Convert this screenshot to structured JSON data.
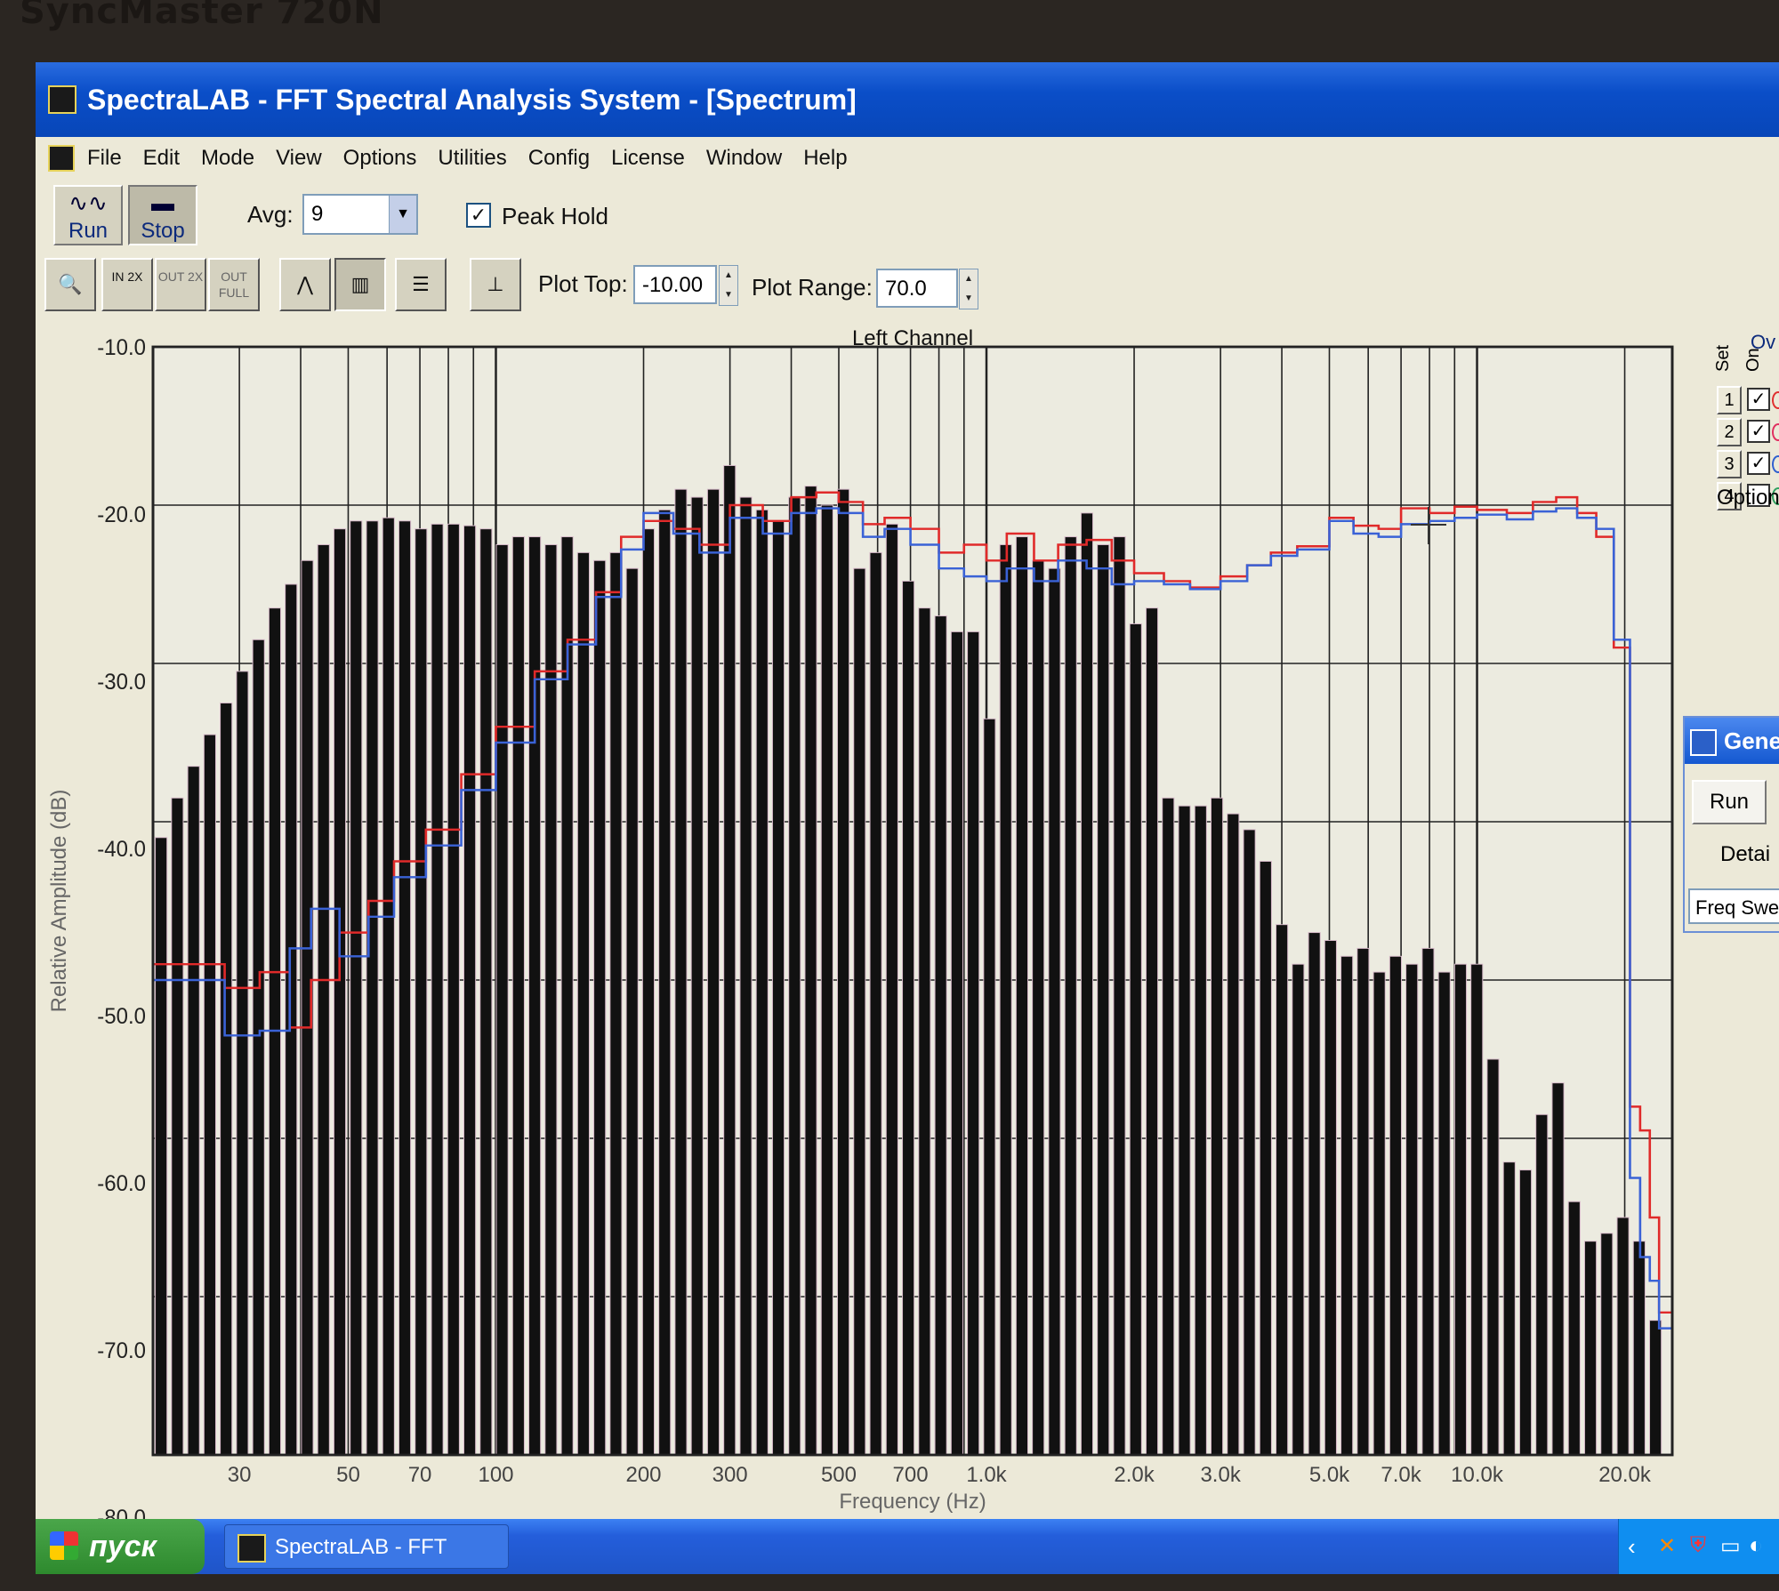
{
  "bezel": {
    "label": "SyncMaster 720N"
  },
  "window": {
    "title": "SpectraLAB - FFT Spectral Analysis System - [Spectrum]"
  },
  "menu": [
    "File",
    "Edit",
    "Mode",
    "View",
    "Options",
    "Utilities",
    "Config",
    "License",
    "Window",
    "Help"
  ],
  "toolbar": {
    "run_label": "Run",
    "stop_label": "Stop",
    "avg_label": "Avg:",
    "avg_value": "9",
    "peak_hold_label": "Peak Hold",
    "peak_hold_checked": true,
    "zoom_in_label": "IN 2X",
    "zoom_out_label": "OUT 2X",
    "zoom_full_label": "OUT FULL",
    "plot_top_label": "Plot Top:",
    "plot_top_value": "-10.00",
    "plot_range_label": "Plot Range:",
    "plot_range_value": "70.0"
  },
  "overlay_panel": {
    "header_partial": "Ov",
    "set_label": "Set",
    "on_label": "On",
    "rows": [
      {
        "set": "1",
        "on": true,
        "color": "#e03030"
      },
      {
        "set": "2",
        "on": true,
        "color": "#e03060"
      },
      {
        "set": "3",
        "on": true,
        "color": "#3060d0"
      },
      {
        "set": "4",
        "on": false,
        "color": "#30a060"
      }
    ],
    "options_label": "Option"
  },
  "generator_panel": {
    "title": "Gene",
    "run_label": "Run",
    "details_label": "Detai",
    "mode_label": "Freq Swe"
  },
  "taskbar": {
    "start_label": "пуск",
    "task_label": "SpectraLAB - FFT Spe..."
  },
  "chart_data": {
    "type": "bar",
    "title": "Left Channel",
    "xlabel": "Frequency (Hz)",
    "ylabel": "Relative Amplitude (dB)",
    "xscale": "log",
    "xlim": [
      20,
      25000
    ],
    "ylim": [
      -80,
      -10
    ],
    "yticks": [
      -10.0,
      -20.0,
      -30.0,
      -40.0,
      -50.0,
      -60.0,
      -70.0,
      -80.0
    ],
    "ytick_labels": [
      "-10.0",
      "-20.0",
      "-30.0",
      "-40.0",
      "-50.0",
      "-60.0",
      "-70.0",
      "-80.0"
    ],
    "xticks": [
      30,
      50,
      70,
      100,
      200,
      300,
      500,
      700,
      1000,
      2000,
      3000,
      5000,
      7000,
      10000,
      20000
    ],
    "xtick_labels": [
      "30",
      "50",
      "70",
      "100",
      "200",
      "300",
      "500",
      "700",
      "1.0k",
      "2.0k",
      "3.0k",
      "5.0k",
      "7.0k",
      "10.0k",
      "20.0k"
    ],
    "grid": true,
    "bars": {
      "name": "Spectrum",
      "freq_start": 20,
      "freq_end": 24000,
      "values": [
        -41.0,
        -38.5,
        -36.5,
        -34.5,
        -32.5,
        -30.5,
        -28.5,
        -26.5,
        -25.0,
        -23.5,
        -22.5,
        -21.5,
        -21.0,
        -21.0,
        -20.8,
        -21.0,
        -21.5,
        -21.2,
        -21.2,
        -21.3,
        -21.5,
        -22.5,
        -22.0,
        -22.0,
        -22.5,
        -22.0,
        -23.0,
        -23.5,
        -23.0,
        -24.0,
        -21.5,
        -20.3,
        -19.0,
        -19.5,
        -19.0,
        -17.5,
        -19.5,
        -20.3,
        -21.0,
        -19.5,
        -18.8,
        -20.0,
        -19.0,
        -24.0,
        -23.0,
        -21.2,
        -24.8,
        -26.5,
        -27.0,
        -28.0,
        -28.0,
        -33.5,
        -22.5,
        -22.0,
        -23.5,
        -24.0,
        -22.0,
        -20.5,
        -22.5,
        -22.0,
        -27.5,
        -26.5,
        -38.5,
        -39.0,
        -39.0,
        -38.5,
        -39.5,
        -40.5,
        -42.5,
        -46.5,
        -49.0,
        -47.0,
        -47.5,
        -48.5,
        -48.0,
        -49.5,
        -48.5,
        -49.0,
        -48.0,
        -49.5,
        -49.0,
        -49.0,
        -55.0,
        -61.5,
        -62.0,
        -58.5,
        -56.5,
        -64.0,
        -66.5,
        -66.0,
        -65.0,
        -66.5,
        -71.5
      ]
    },
    "series": [
      {
        "name": "Overlay 1",
        "color": "#e02a2a",
        "points": [
          [
            20,
            -49.0
          ],
          [
            28,
            -50.5
          ],
          [
            33,
            -49.5
          ],
          [
            38,
            -53.0
          ],
          [
            42,
            -50.0
          ],
          [
            48,
            -47.0
          ],
          [
            55,
            -45.0
          ],
          [
            62,
            -42.5
          ],
          [
            72,
            -40.5
          ],
          [
            85,
            -37.0
          ],
          [
            100,
            -34.0
          ],
          [
            120,
            -30.5
          ],
          [
            140,
            -28.5
          ],
          [
            160,
            -25.5
          ],
          [
            180,
            -22.0
          ],
          [
            200,
            -21.0
          ],
          [
            230,
            -21.5
          ],
          [
            260,
            -22.5
          ],
          [
            300,
            -20.0
          ],
          [
            350,
            -21.0
          ],
          [
            400,
            -19.5
          ],
          [
            450,
            -19.2
          ],
          [
            500,
            -19.8
          ],
          [
            560,
            -21.2
          ],
          [
            620,
            -20.8
          ],
          [
            700,
            -21.5
          ],
          [
            800,
            -23.0
          ],
          [
            900,
            -22.5
          ],
          [
            1000,
            -23.5
          ],
          [
            1100,
            -21.8
          ],
          [
            1250,
            -23.5
          ],
          [
            1400,
            -22.5
          ],
          [
            1600,
            -22.2
          ],
          [
            1800,
            -23.5
          ],
          [
            2000,
            -24.3
          ],
          [
            2300,
            -24.8
          ],
          [
            2600,
            -25.2
          ],
          [
            3000,
            -24.5
          ],
          [
            3400,
            -23.8
          ],
          [
            3800,
            -23.0
          ],
          [
            4300,
            -22.6
          ],
          [
            5000,
            -20.8
          ],
          [
            5600,
            -21.3
          ],
          [
            6300,
            -21.5
          ],
          [
            7000,
            -20.2
          ],
          [
            8000,
            -20.5
          ],
          [
            9000,
            -20.1
          ],
          [
            10000,
            -20.3
          ],
          [
            11500,
            -20.5
          ],
          [
            13000,
            -19.8
          ],
          [
            14500,
            -19.5
          ],
          [
            16000,
            -20.5
          ],
          [
            17500,
            -22.0
          ],
          [
            19000,
            -29.0
          ],
          [
            20500,
            -58.0
          ],
          [
            21500,
            -59.5
          ],
          [
            22500,
            -65.0
          ],
          [
            23500,
            -71.0
          ]
        ]
      },
      {
        "name": "Overlay 3",
        "color": "#3a62d6",
        "points": [
          [
            20,
            -50.0
          ],
          [
            28,
            -53.5
          ],
          [
            33,
            -53.2
          ],
          [
            38,
            -48.0
          ],
          [
            42,
            -45.5
          ],
          [
            48,
            -48.5
          ],
          [
            55,
            -46.0
          ],
          [
            62,
            -43.5
          ],
          [
            72,
            -41.5
          ],
          [
            85,
            -38.0
          ],
          [
            100,
            -35.0
          ],
          [
            120,
            -31.0
          ],
          [
            140,
            -28.8
          ],
          [
            160,
            -25.8
          ],
          [
            180,
            -22.8
          ],
          [
            200,
            -20.5
          ],
          [
            230,
            -21.8
          ],
          [
            260,
            -23.0
          ],
          [
            300,
            -20.8
          ],
          [
            350,
            -21.8
          ],
          [
            400,
            -20.5
          ],
          [
            450,
            -20.2
          ],
          [
            500,
            -20.5
          ],
          [
            560,
            -22.0
          ],
          [
            620,
            -21.5
          ],
          [
            700,
            -22.5
          ],
          [
            800,
            -24.0
          ],
          [
            900,
            -24.5
          ],
          [
            1000,
            -24.8
          ],
          [
            1100,
            -24.0
          ],
          [
            1250,
            -24.8
          ],
          [
            1400,
            -23.5
          ],
          [
            1600,
            -24.0
          ],
          [
            1800,
            -25.0
          ],
          [
            2000,
            -24.8
          ],
          [
            2300,
            -25.0
          ],
          [
            2600,
            -25.3
          ],
          [
            3000,
            -24.8
          ],
          [
            3400,
            -23.8
          ],
          [
            3800,
            -23.2
          ],
          [
            4300,
            -22.8
          ],
          [
            5000,
            -21.0
          ],
          [
            5600,
            -21.8
          ],
          [
            6300,
            -22.0
          ],
          [
            7000,
            -21.2
          ],
          [
            8000,
            -21.0
          ],
          [
            9000,
            -20.8
          ],
          [
            10000,
            -20.6
          ],
          [
            11500,
            -20.9
          ],
          [
            13000,
            -20.4
          ],
          [
            14500,
            -20.2
          ],
          [
            16000,
            -20.8
          ],
          [
            17500,
            -21.5
          ],
          [
            19000,
            -28.5
          ],
          [
            20500,
            -62.5
          ],
          [
            21500,
            -67.5
          ],
          [
            22500,
            -69.0
          ],
          [
            23500,
            -72.0
          ]
        ]
      }
    ]
  }
}
